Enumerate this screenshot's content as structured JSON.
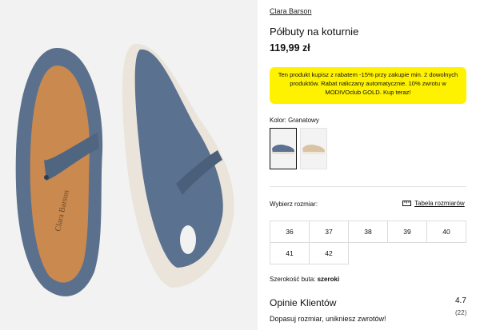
{
  "product": {
    "brand": "Clara Barson",
    "title": "Półbuty na koturnie",
    "price": "119,99 zł"
  },
  "promo": {
    "text": "Ten produkt kupisz z rabatem -15% przy zakupie min. 2 dowolnych produktów. Rabat naliczany automatycznie. 10% zwrotu w MODIVOclub GOLD. Kup teraz!",
    "color": "#fff200"
  },
  "color_picker": {
    "label": "Kolor:",
    "value": "Granatowy",
    "swatches": [
      "Granatowy",
      "beige"
    ]
  },
  "sizes": {
    "label": "Wybierz rozmiar:",
    "chart_link": "Tabela rozmiarów",
    "options": [
      "36",
      "37",
      "38",
      "39",
      "40",
      "41",
      "42"
    ]
  },
  "width": {
    "label": "Szerokość buta:",
    "value": "szeroki"
  },
  "reviews": {
    "title": "Opinie Klientów",
    "subtitle": "Dopasuj rozmiar, unikniesz zwrotów!",
    "rating": "4.7",
    "count": "(22)"
  },
  "insole_text": "Clara Barson"
}
